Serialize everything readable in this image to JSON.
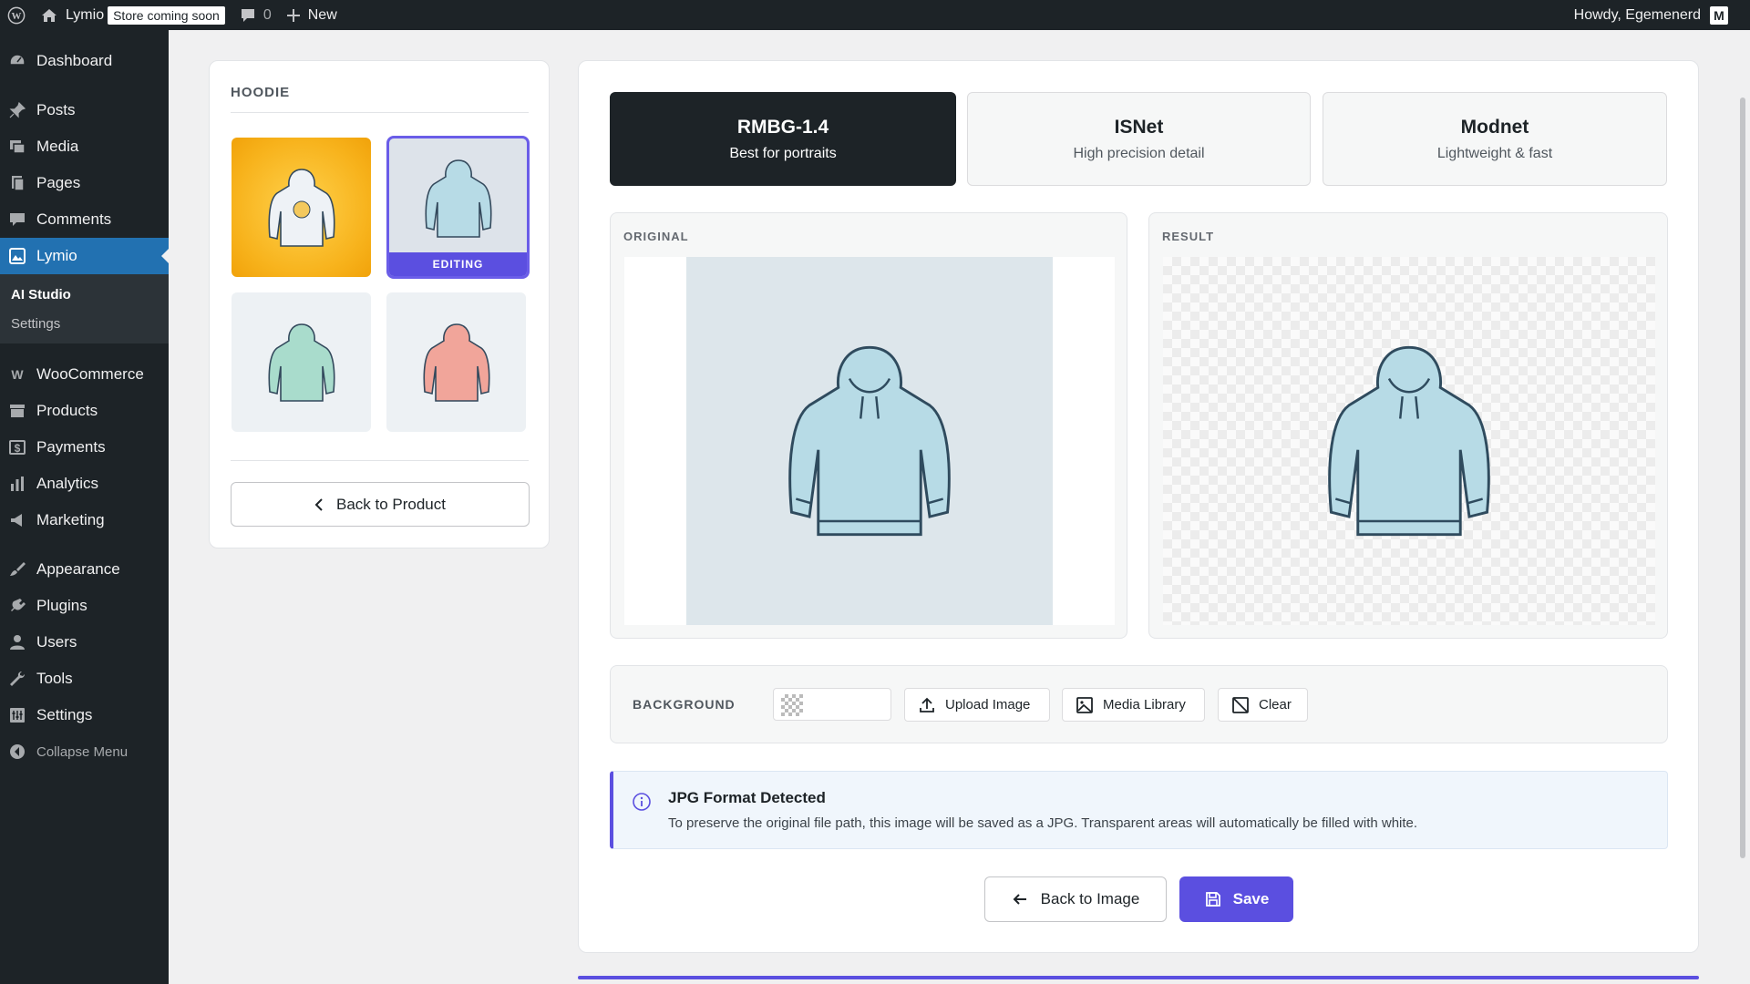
{
  "adminbar": {
    "site_name": "Lymio",
    "badge": "Store coming soon",
    "comments_count": "0",
    "new_label": "New",
    "howdy": "Howdy, Egemenerd",
    "avatar_letter": "M"
  },
  "sidebar": {
    "dashboard": "Dashboard",
    "posts": "Posts",
    "media": "Media",
    "pages": "Pages",
    "comments": "Comments",
    "lymio": "Lymio",
    "sub_ai_studio": "AI Studio",
    "sub_settings": "Settings",
    "woocommerce": "WooCommerce",
    "products": "Products",
    "payments": "Payments",
    "analytics": "Analytics",
    "marketing": "Marketing",
    "appearance": "Appearance",
    "plugins": "Plugins",
    "users": "Users",
    "tools": "Tools",
    "settings": "Settings",
    "collapse": "Collapse Menu"
  },
  "product_panel": {
    "title": "HOODIE",
    "editing_badge": "EDITING",
    "back_label": "Back to Product"
  },
  "models": [
    {
      "title": "RMBG-1.4",
      "subtitle": "Best for portraits"
    },
    {
      "title": "ISNet",
      "subtitle": "High precision detail"
    },
    {
      "title": "Modnet",
      "subtitle": "Lightweight & fast"
    }
  ],
  "preview": {
    "original_label": "ORIGINAL",
    "result_label": "RESULT"
  },
  "background": {
    "label": "BACKGROUND",
    "upload": "Upload Image",
    "media_library": "Media Library",
    "clear": "Clear"
  },
  "notice": {
    "title": "JPG Format Detected",
    "text": "To preserve the original file path, this image will be saved as a JPG. Transparent areas will automatically be filled with white."
  },
  "actions": {
    "back_to_image": "Back to Image",
    "save": "Save"
  },
  "colors": {
    "accent": "#5b4fe0",
    "selected_model": "#1d2327"
  }
}
